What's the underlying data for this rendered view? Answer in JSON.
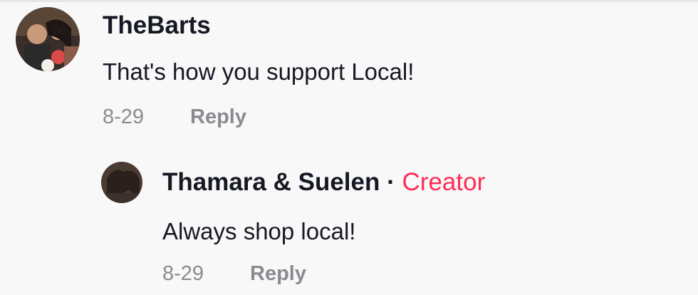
{
  "comments": [
    {
      "username": "TheBarts",
      "text": "That's how you support Local!",
      "date": "8-29",
      "reply_label": "Reply",
      "avatar_icon": "user-avatar-photo"
    }
  ],
  "reply": {
    "username": "Thamara & Suelen",
    "separator": "·",
    "badge": "Creator",
    "text": "Always shop local!",
    "date": "8-29",
    "reply_label": "Reply",
    "avatar_icon": "user-avatar-photo"
  },
  "colors": {
    "background": "#f8f8f8",
    "username": "#161823",
    "meta": "#8a8b91",
    "creator_badge": "#fe2c55"
  }
}
